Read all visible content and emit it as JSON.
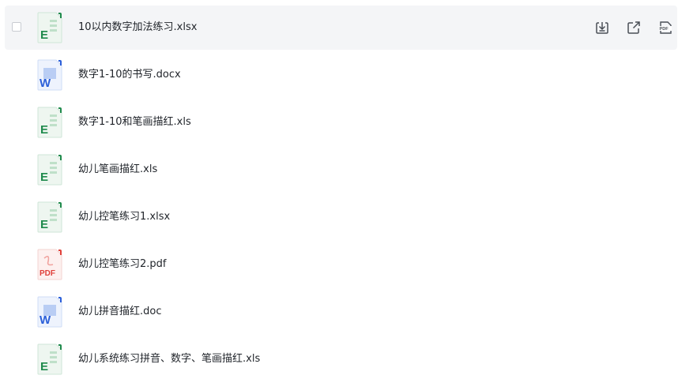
{
  "colors": {
    "row_hover": "#f4f5f7",
    "text": "#1f2329",
    "excel_green": "#1f8a4c",
    "word_blue": "#2b5fd9",
    "pdf_red": "#e0403a"
  },
  "actions": {
    "download_icon": "download-icon",
    "share_icon": "open-external-icon",
    "pdf_icon": "export-pdf-icon"
  },
  "files": [
    {
      "name": "10以内数字加法练习.xlsx",
      "type": "excel"
    },
    {
      "name": "数字1-10的书写.docx",
      "type": "word"
    },
    {
      "name": "数字1-10和笔画描红.xls",
      "type": "excel"
    },
    {
      "name": "幼儿笔画描红.xls",
      "type": "excel"
    },
    {
      "name": "幼儿控笔练习1.xlsx",
      "type": "excel"
    },
    {
      "name": "幼儿控笔练习2.pdf",
      "type": "pdf"
    },
    {
      "name": "幼儿拼音描红.doc",
      "type": "word"
    },
    {
      "name": "幼儿系统练习拼音、数字、笔画描红.xls",
      "type": "excel"
    }
  ]
}
